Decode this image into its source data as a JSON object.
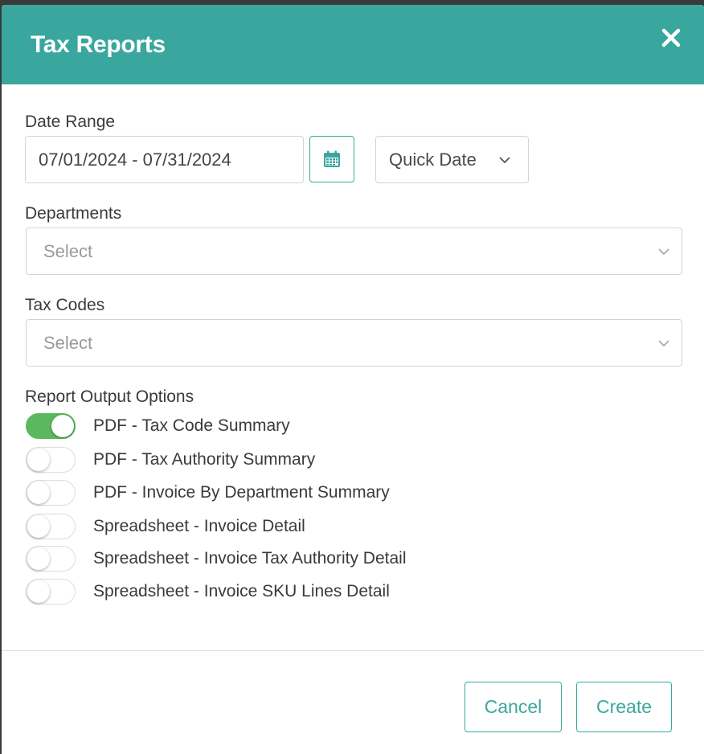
{
  "modal": {
    "title": "Tax Reports",
    "colors": {
      "header": "#3aa79e",
      "accent": "#3aa79e",
      "toggle_on": "#5cb85c"
    }
  },
  "date_range": {
    "label": "Date Range",
    "value": "07/01/2024 - 07/31/2024",
    "calendar_icon": "calendar-icon",
    "quick_date": {
      "label": "Quick Date",
      "icon": "chevron-down-icon"
    }
  },
  "departments": {
    "label": "Departments",
    "placeholder": "Select"
  },
  "tax_codes": {
    "label": "Tax Codes",
    "placeholder": "Select"
  },
  "report_output": {
    "label": "Report Output Options",
    "options": [
      {
        "label": "PDF - Tax Code Summary",
        "enabled": true
      },
      {
        "label": "PDF - Tax Authority Summary",
        "enabled": false
      },
      {
        "label": "PDF - Invoice By Department Summary",
        "enabled": false
      },
      {
        "label": "Spreadsheet - Invoice Detail",
        "enabled": false
      },
      {
        "label": "Spreadsheet - Invoice Tax Authority Detail",
        "enabled": false
      },
      {
        "label": "Spreadsheet - Invoice SKU Lines Detail",
        "enabled": false
      }
    ]
  },
  "footer": {
    "cancel_label": "Cancel",
    "create_label": "Create"
  }
}
